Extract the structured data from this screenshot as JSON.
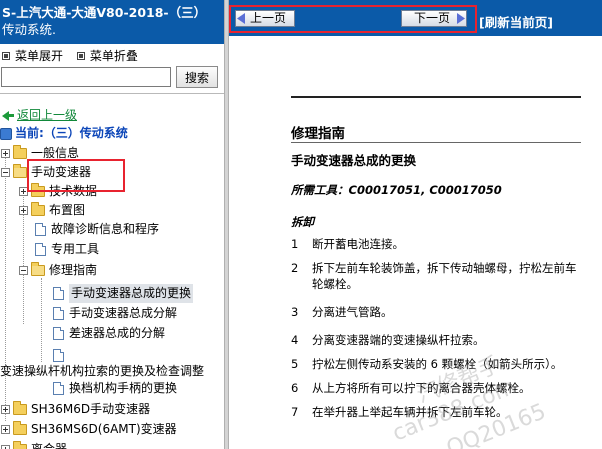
{
  "left_header": {
    "title_line1": "S-上汽大通-大通V80-2018-（三）",
    "title_line2": "传动系统."
  },
  "menu": {
    "expand_label": "菜单展开",
    "collapse_label": "菜单折叠"
  },
  "search": {
    "value": "",
    "placeholder": "",
    "button_label": "搜索"
  },
  "tree": {
    "back_label": "返回上一级",
    "current_label": "当前:（三）传动系统",
    "items": [
      {
        "label": "一般信息"
      },
      {
        "label": "手动变速器"
      },
      {
        "label": "技术数据"
      },
      {
        "label": "布置图"
      },
      {
        "label": "故障诊断信息和程序"
      },
      {
        "label": "专用工具"
      },
      {
        "label": "修理指南"
      },
      {
        "label": "手动变速器总成的更换"
      },
      {
        "label": "手动变速器总成分解"
      },
      {
        "label": "差速器总成的分解"
      },
      {
        "label": ""
      },
      {
        "label": "变速操纵杆机构拉索的更换及检查调整"
      },
      {
        "label": "换档机构手柄的更换"
      },
      {
        "label": "SH36M6D手动变速器"
      },
      {
        "label": "SH36MS6D(6AMT)变速器"
      },
      {
        "label": "离合器"
      }
    ]
  },
  "topbar": {
    "prev_label": "上一页",
    "next_label": "下一页",
    "refresh_label": "[刷新当前页]"
  },
  "document": {
    "section_title": "修理指南",
    "doc_title": "手动变速器总成的更换",
    "tools_line": "所需工具：C00017051, C00017050",
    "removal_heading": "拆卸",
    "steps": [
      {
        "num": "1",
        "text": "断开蓄电池连接。"
      },
      {
        "num": "2",
        "text": "拆下左前车轮装饰盖，拆下传动轴螺母，拧松左前车轮螺栓。"
      },
      {
        "num": "3",
        "text": "分离进气管路。"
      },
      {
        "num": "4",
        "text": "分离变速器端的变速操纵杆拉索。"
      },
      {
        "num": "5",
        "text": "拧松左侧传动系安装的 6 颗螺栓（如箭头所示）。"
      },
      {
        "num": "6",
        "text": "从上方将所有可以拧下的离合器壳体螺栓。"
      },
      {
        "num": "7",
        "text": "在举升器上举起车辆并拆下左前车轮。"
      }
    ]
  },
  "watermarks": {
    "text1": "汽修帮手",
    "text2": "car388.com",
    "text3": "QQ20165"
  },
  "colors": {
    "header_blue": "#0b5aa8",
    "highlight_red": "#e8232f",
    "link_green": "#11883a",
    "current_blue": "#0b45b8"
  }
}
